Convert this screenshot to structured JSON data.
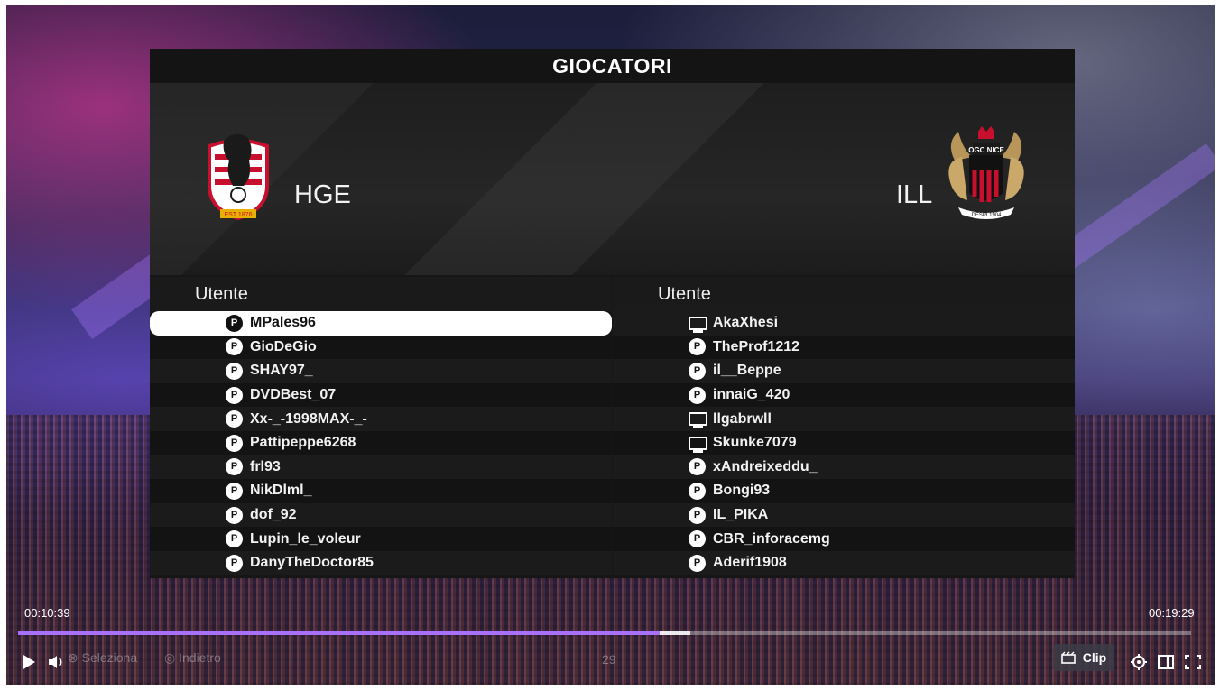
{
  "panel": {
    "title": "GIOCATORI",
    "home_team": "HGE",
    "away_team": "ILL",
    "home_crest_text": "EST 1876",
    "away_crest_text": "OGC NICE",
    "away_crest_subtext": "DESPI 1904"
  },
  "left_list": {
    "header": "Utente",
    "players": [
      {
        "name": "MPales96",
        "platform": "playstation-icon",
        "selected": true
      },
      {
        "name": "GioDeGio",
        "platform": "playstation-icon"
      },
      {
        "name": "SHAY97_",
        "platform": "playstation-icon"
      },
      {
        "name": "DVDBest_07",
        "platform": "playstation-icon"
      },
      {
        "name": "Xx-_-1998MAX-_-",
        "platform": "playstation-icon"
      },
      {
        "name": "Pattipeppe6268",
        "platform": "playstation-icon"
      },
      {
        "name": "frl93",
        "platform": "playstation-icon"
      },
      {
        "name": "NikDlml_",
        "platform": "playstation-icon"
      },
      {
        "name": "dof_92",
        "platform": "playstation-icon"
      },
      {
        "name": "Lupin_le_voleur",
        "platform": "playstation-icon"
      },
      {
        "name": "DanyTheDoctor85",
        "platform": "playstation-icon"
      }
    ]
  },
  "right_list": {
    "header": "Utente",
    "players": [
      {
        "name": "AkaXhesi",
        "platform": "pc-icon"
      },
      {
        "name": "TheProf1212",
        "platform": "playstation-icon"
      },
      {
        "name": "il__Beppe",
        "platform": "playstation-icon"
      },
      {
        "name": "innaiG_420",
        "platform": "playstation-icon"
      },
      {
        "name": "llgabrwll",
        "platform": "pc-icon"
      },
      {
        "name": "Skunke7079",
        "platform": "pc-icon"
      },
      {
        "name": "xAndreixeddu_",
        "platform": "playstation-icon"
      },
      {
        "name": "Bongi93",
        "platform": "playstation-icon"
      },
      {
        "name": "IL_PIKA",
        "platform": "playstation-icon"
      },
      {
        "name": "CBR_inforacemg",
        "platform": "playstation-icon"
      },
      {
        "name": "Aderif1908",
        "platform": "playstation-icon"
      }
    ]
  },
  "player": {
    "current_time": "00:10:39",
    "total_time": "00:19:29",
    "progress_fraction": 0.547,
    "buffered_fraction": 0.573,
    "game_hint_select": "Seleziona",
    "game_hint_back": "Indietro",
    "game_hint_number": "29",
    "clip_label": "Clip",
    "accent_color": "#a970ff"
  }
}
